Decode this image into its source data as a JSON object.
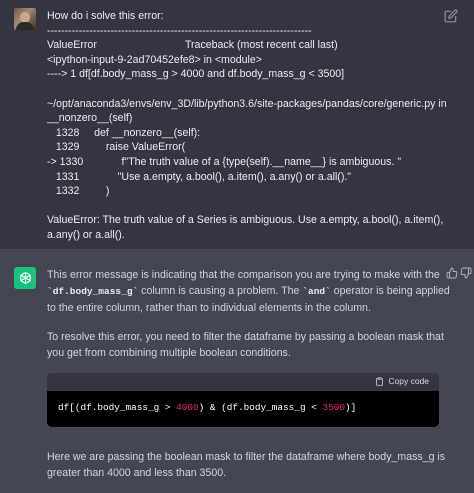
{
  "user_message": {
    "lines": [
      "How do i solve this error:",
      "---------------------------------------------------------------------------",
      "ValueError                              Traceback (most recent call last)",
      "<ipython-input-9-2ad70452efe8> in <module>",
      "----> 1 df[df.body_mass_g > 4000 and df.body_mass_g < 3500]",
      "",
      "~/opt/anaconda3/envs/env_3D/lib/python3.6/site-packages/pandas/core/generic.py in",
      "__nonzero__(self)",
      "   1328     def __nonzero__(self):",
      "   1329         raise ValueError(",
      "-> 1330             f\"The truth value of a {type(self).__name__} is ambiguous. \"",
      "   1331             \"Use a.empty, a.bool(), a.item(), a.any() or a.all().\"",
      "   1332         )",
      "",
      "ValueError: The truth value of a Series is ambiguous. Use a.empty, a.bool(), a.item(),",
      "a.any() or a.all()."
    ]
  },
  "assistant_message": {
    "p1_before": "This error message is indicating that the comparison you are trying to make with the ",
    "p1_code1": "`df.body_mass_g`",
    "p1_middle": " column is causing a problem. The ",
    "p1_code2": "`and`",
    "p1_after": " operator is being applied to the entire column, rather than to individual elements in the column.",
    "p2": "To resolve this error, you need to filter the dataframe by passing a boolean mask that you get from combining multiple boolean conditions.",
    "code": {
      "copy_label": "Copy code",
      "part1": "df[(df.body_mass_g > ",
      "num1": "4000",
      "part2": ") & (df.body_mass_g < ",
      "num2": "3500",
      "part3": ")]"
    },
    "p3": "Here we are passing the boolean mask to filter the dataframe where body_mass_g is greater than 4000 and less than 3500."
  },
  "icons": {
    "edit": "edit-icon",
    "thumbs_up": "thumbs-up-icon",
    "thumbs_down": "thumbs-down-icon",
    "copy": "clipboard-icon",
    "assistant_logo": "openai-logo-icon"
  },
  "colors": {
    "user_bg": "#343541",
    "assistant_bg": "#444654",
    "assistant_avatar": "#19c37d",
    "code_bg": "#000000",
    "code_number": "#df3079"
  }
}
